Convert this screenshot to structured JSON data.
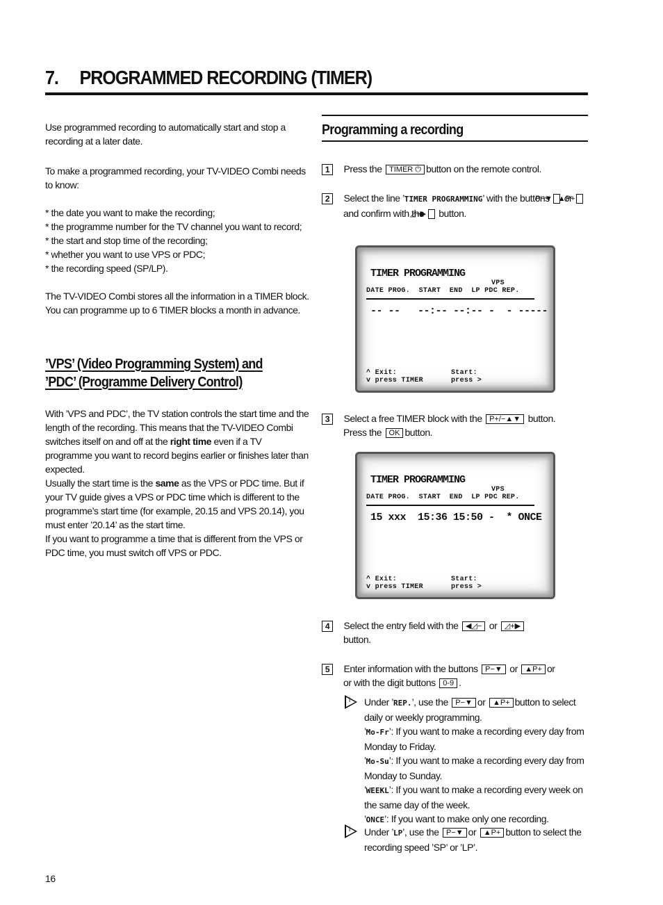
{
  "title": {
    "number": "7.",
    "text": "PROGRAMMED RECORDING (TIMER)"
  },
  "left": {
    "intro": "Use programmed recording to automatically start and stop a recording at a later date.",
    "needs_intro": "To make a programmed recording, your TV-VIDEO Combi needs to know:",
    "needs": [
      "* the date you want to make the recording;",
      "* the programme number for the TV channel you want to record;",
      "* the start and stop time of the recording;",
      "* whether you want to use VPS or PDC;",
      "* the recording speed (SP/LP)."
    ],
    "blocks": "The TV-VIDEO Combi stores all the information in a TIMER block. You can programme up to 6 TIMER blocks a month in advance.",
    "vps_heading_1": "’VPS’ (Video Programming System) and",
    "vps_heading_2": "’PDC’ (Programme Delivery Control)",
    "vps_p1a": "With ’VPS and PDC’, the TV station controls the start time and the length of the recording. This means that the TV-VIDEO Combi switches itself on and off at the ",
    "vps_p1b": "right time",
    "vps_p1c": " even if a TV programme you want to record begins earlier or finishes later than expected.",
    "vps_p2a": "Usually the start time is the ",
    "vps_p2b": "same",
    "vps_p2c": " as the VPS or PDC time. But if your TV guide gives a VPS or PDC time which is different to the programme’s start time (for example, 20.15 and VPS 20.14), you must enter ’20.14’ as the start time.",
    "vps_p3": "If you want to programme a time that is different from the VPS or PDC time, you must switch off VPS or PDC."
  },
  "right": {
    "heading": "Programming a recording",
    "buttons": {
      "timer": "TIMER ⏻",
      "p_down": "P−▼",
      "p_up": "▲P+",
      "right": "◿+▶",
      "left": "◀◿−",
      "pplus_pminus": "P+/−▲▼",
      "ok": "OK",
      "digits": "0-9"
    },
    "step1": {
      "num": "1",
      "a": "Press the",
      "b": "button on the remote control."
    },
    "step2": {
      "num": "2",
      "a": "Select the line ’",
      "code": "TIMER PROGRAMMING",
      "b": "’ with the buttons",
      "or": "or",
      "c": "and confirm with the",
      "d": "button."
    },
    "step3": {
      "num": "3",
      "a": "Select a free TIMER block with the",
      "b": "button.",
      "c": "Press the",
      "d": "button."
    },
    "step4": {
      "num": "4",
      "a": "Select the entry field with the",
      "or": "or",
      "b": "button."
    },
    "step5": {
      "num": "5",
      "a": "Enter information with the buttons",
      "or": "or",
      "b": "or with the digit buttons",
      "c": "."
    },
    "tip1": {
      "icon": "info-icon",
      "a": "Under ’",
      "code": "REP.",
      "b": "’, use the",
      "or": "or",
      "c": "button to select daily or weekly programming.",
      "options": [
        {
          "code": "Mo-Fr",
          "text": ": If you want to make a recording every day from Monday to Friday."
        },
        {
          "code": "Mo-Su",
          "text": ": If you want to make a recording every day from Monday to Sunday."
        },
        {
          "code": "WEEKL",
          "text": ": If you want to make a recording every week on the same day of the week."
        },
        {
          "code": "ONCE",
          "text": ": If you want to make only one recording."
        }
      ]
    },
    "tip2": {
      "icon": "info-icon",
      "a": "Under ’",
      "code": "LP",
      "b": "’, use the",
      "or": "or",
      "c": "button to select the recording speed ’SP’ or ’LP’."
    }
  },
  "screens": [
    {
      "title": "TIMER PROGRAMMING",
      "vps": "VPS",
      "columns": "DATE PROG.  START  END  LP PDC REP.",
      "values": "-- --   --:-- --:-- -  - -----",
      "exit1": "^ Exit:",
      "exit2": "v press TIMER",
      "start1": "Start:",
      "start2": "press >"
    },
    {
      "title": "TIMER PROGRAMMING",
      "vps": "VPS",
      "columns": "DATE PROG.  START  END  LP PDC REP.",
      "values": "15 xxx  15:36 15:50 -  * ONCE",
      "exit1": "^ Exit:",
      "exit2": "v press TIMER",
      "start1": "Start:",
      "start2": "press >"
    }
  ],
  "page_number": "16"
}
